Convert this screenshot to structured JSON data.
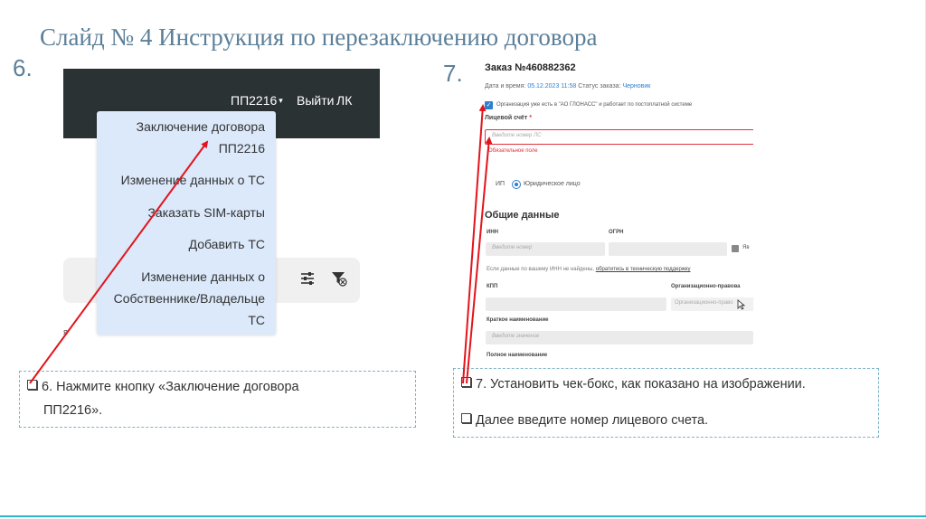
{
  "slide": {
    "title": "Слайд № 4 Инструкция по перезаключению договора",
    "step6_number": "6.",
    "step7_number": "7."
  },
  "left_screenshot": {
    "topbar": {
      "account": "ПП2216",
      "account_caret": "▾",
      "logout": "Выйти",
      "cabinet": "ЛК"
    },
    "dropdown_items": [
      {
        "line1": "Заключение договора",
        "line2": "ПП2216"
      },
      {
        "line1": "Изменение данных о ТС"
      },
      {
        "line1": "Заказать SIM-карты"
      },
      {
        "line1": "Добавить ТС"
      },
      {
        "line1": "Изменение данных о",
        "line2": "Собственнике/Владельце",
        "line3": "ТС"
      }
    ],
    "panel_icons": [
      "sliders-icon",
      "filter-clear-icon"
    ],
    "stray_text": "я"
  },
  "callouts": {
    "step6": {
      "line1": "6. Нажмите кнопку «Заключение договора",
      "line2": "ПП2216»."
    },
    "step7": {
      "line1": "7. Установить чек-бокс, как показано на изображении.",
      "line2": "Далее введите номер лицевого счета."
    }
  },
  "order_form": {
    "title": "Заказ №460882362",
    "datetime_label": "Дата и время:",
    "datetime_value": "05.12.2023 11:58",
    "status_label": "Статус заказа:",
    "status_value": "Черновик",
    "checkbox_label": "Организация уже есть в \"АО ГЛОНАСС\" и работает по постоплатной системе",
    "account_label": "Лицевой счёт",
    "account_required": "*",
    "account_placeholder": "Введите номер ЛС",
    "account_error": "Обязательное поле",
    "radio_ip": "ИП",
    "radio_legal": "Юридическое лицо",
    "section_title": "Общие данные",
    "inn_label": "ИНН",
    "inn_placeholder": "Введите номер",
    "ogrn_label": "ОГРН",
    "truncated_check_label": "Яв",
    "hint_text": "Если данные по вашему ИНН не найдены,",
    "hint_link": "обратитесь в техническую поддержку",
    "kpp_label": "КПП",
    "org_form_label": "Организационно-правова",
    "org_form_placeholder": "Организационно-право",
    "short_name_label": "Краткое наименование",
    "short_name_placeholder": "Введите значение",
    "full_name_label": "Полное наименование"
  },
  "colors": {
    "title": "#5b7f99",
    "arrow": "#e3141b",
    "accent_line": "#2ab7c9",
    "dropdown_bg": "#dbe9fb",
    "topbar_bg": "#2b3234",
    "error": "#e0303a",
    "link": "#2d7fd1"
  }
}
